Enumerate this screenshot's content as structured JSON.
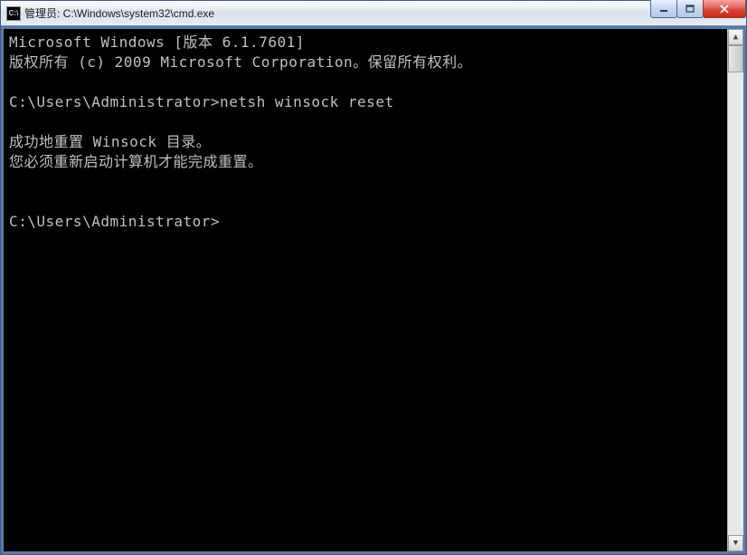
{
  "window": {
    "title": "管理员: C:\\Windows\\system32\\cmd.exe",
    "icon_label": "C:\\"
  },
  "console": {
    "lines": [
      "Microsoft Windows [版本 6.1.7601]",
      "版权所有 (c) 2009 Microsoft Corporation。保留所有权利。",
      "",
      "C:\\Users\\Administrator>netsh winsock reset",
      "",
      "成功地重置 Winsock 目录。",
      "您必须重新启动计算机才能完成重置。",
      "",
      "",
      "C:\\Users\\Administrator>"
    ]
  }
}
